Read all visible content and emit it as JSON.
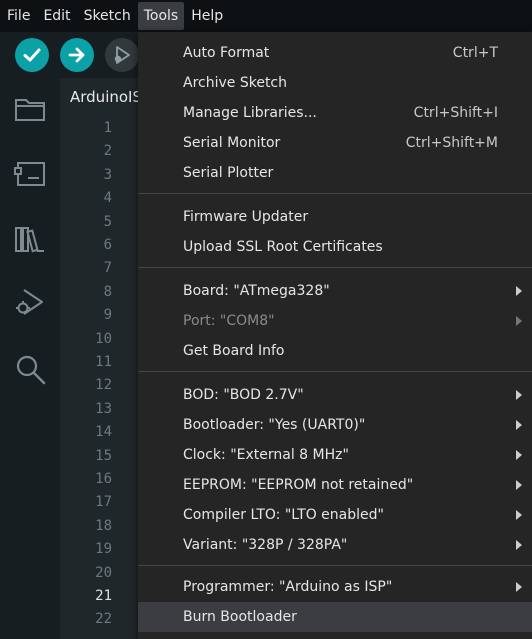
{
  "menubar": {
    "items": [
      "File",
      "Edit",
      "Sketch",
      "Tools",
      "Help"
    ]
  },
  "tab": {
    "label": "ArduinoISP"
  },
  "editor": {
    "line_numbers": [
      "1",
      "2",
      "3",
      "4",
      "5",
      "6",
      "7",
      "8",
      "9",
      "10",
      "11",
      "12",
      "13",
      "14",
      "15",
      "16",
      "17",
      "18",
      "19",
      "20",
      "21",
      "22"
    ],
    "current_line": "21"
  },
  "tools_menu": {
    "auto_format": {
      "label": "Auto Format",
      "shortcut": "Ctrl+T"
    },
    "archive_sketch": {
      "label": "Archive Sketch"
    },
    "manage_libraries": {
      "label": "Manage Libraries...",
      "shortcut": "Ctrl+Shift+I"
    },
    "serial_monitor": {
      "label": "Serial Monitor",
      "shortcut": "Ctrl+Shift+M"
    },
    "serial_plotter": {
      "label": "Serial Plotter"
    },
    "firmware_updater": {
      "label": "Firmware Updater"
    },
    "upload_ssl": {
      "label": "Upload SSL Root Certificates"
    },
    "board": {
      "label": "Board: \"ATmega328\""
    },
    "port": {
      "label": "Port: \"COM8\""
    },
    "get_board_info": {
      "label": "Get Board Info"
    },
    "bod": {
      "label": "BOD: \"BOD 2.7V\""
    },
    "bootloader": {
      "label": "Bootloader: \"Yes (UART0)\""
    },
    "clock": {
      "label": "Clock: \"External 8 MHz\""
    },
    "eeprom": {
      "label": "EEPROM: \"EEPROM not retained\""
    },
    "compiler_lto": {
      "label": "Compiler LTO: \"LTO enabled\""
    },
    "variant": {
      "label": "Variant: \"328P / 328PA\""
    },
    "programmer": {
      "label": "Programmer: \"Arduino as ISP\""
    },
    "burn_bootloader": {
      "label": "Burn Bootloader"
    }
  },
  "icons": {
    "verify": "check-icon",
    "upload": "arrow-right-icon",
    "debug": "debug-icon",
    "sketchbook": "folder-icon",
    "boards": "board-icon",
    "libraries": "library-icon",
    "debugger": "debug-side-icon",
    "search": "search-icon"
  },
  "colors": {
    "accent": "#0ca1a6",
    "menu_bg": "#252526",
    "app_bg": "#171e21"
  }
}
